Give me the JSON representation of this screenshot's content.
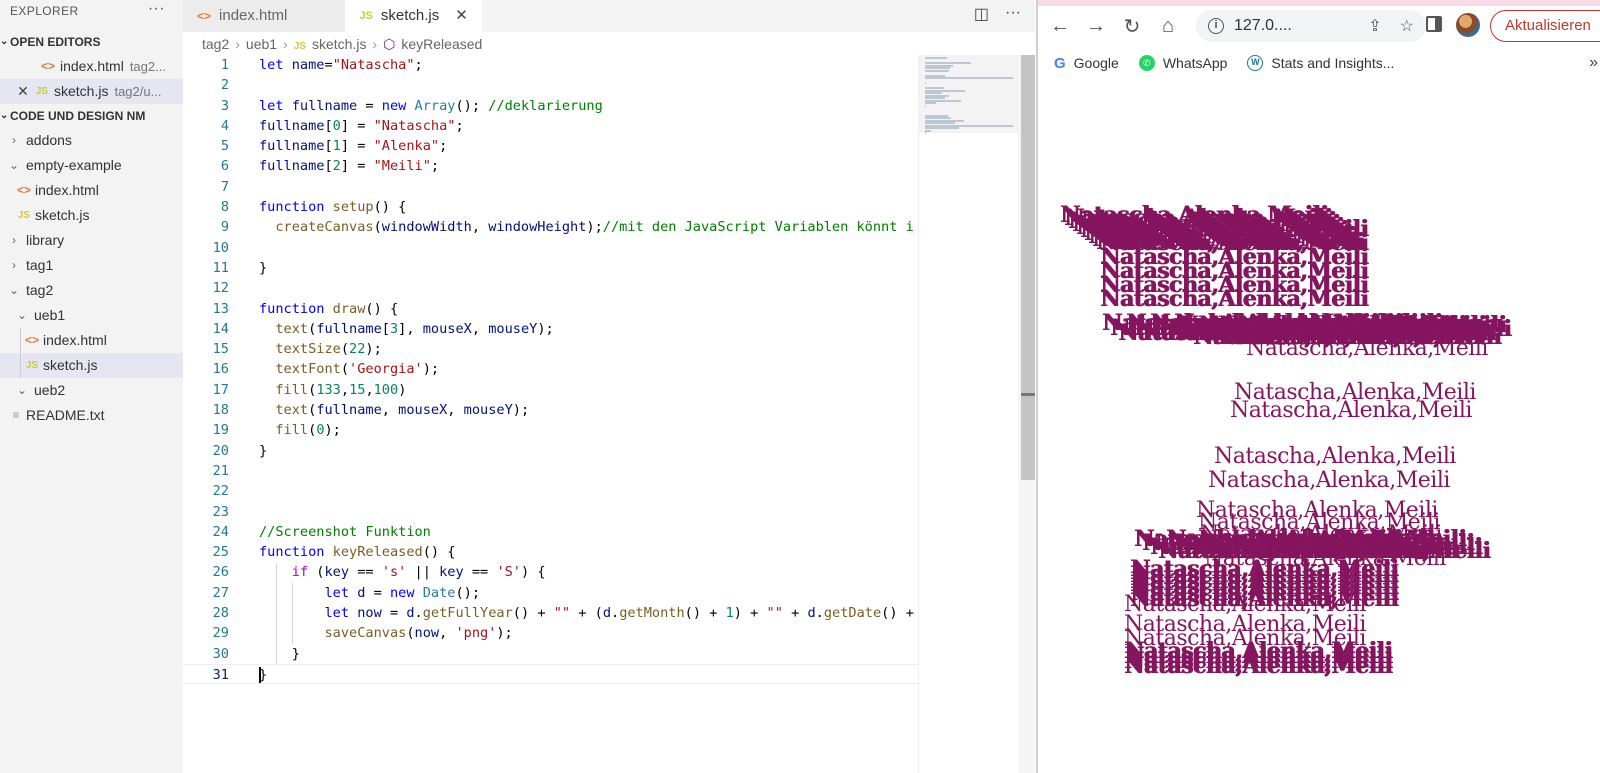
{
  "sidebar": {
    "title": "EXPLORER",
    "more": "···",
    "open_editors_label": "OPEN EDITORS",
    "open_editors": [
      {
        "name": "index.html",
        "path": "tag2..."
      },
      {
        "name": "sketch.js",
        "path": "tag2/u..."
      }
    ],
    "project_label": "CODE UND DESIGN NM",
    "tree": [
      {
        "label": "addons"
      },
      {
        "label": "empty-example"
      },
      {
        "label": "index.html"
      },
      {
        "label": "sketch.js"
      },
      {
        "label": "library"
      },
      {
        "label": "tag1"
      },
      {
        "label": "tag2"
      },
      {
        "label": "ueb1"
      },
      {
        "label": "index.html"
      },
      {
        "label": "sketch.js"
      },
      {
        "label": "ueb2"
      },
      {
        "label": "README.txt"
      }
    ]
  },
  "editor": {
    "tabs": [
      {
        "label": "index.html",
        "icon": "html-file-icon"
      },
      {
        "label": "sketch.js",
        "icon": "js-file-icon"
      }
    ],
    "breadcrumb": [
      "tag2",
      "ueb1",
      "sketch.js",
      "keyReleased"
    ],
    "code_lines": [
      [
        [
          "k",
          "let"
        ],
        [
          "p",
          " "
        ],
        [
          "v",
          "name"
        ],
        [
          "p",
          "="
        ],
        [
          "s",
          "\"Natascha\""
        ],
        [
          "p",
          ";"
        ]
      ],
      [],
      [
        [
          "k",
          "let"
        ],
        [
          "p",
          " "
        ],
        [
          "v",
          "fullname"
        ],
        [
          "p",
          " = "
        ],
        [
          "k",
          "new"
        ],
        [
          "p",
          " "
        ],
        [
          "ty",
          "Array"
        ],
        [
          "p",
          "(); "
        ],
        [
          "cm",
          "//deklarierung"
        ]
      ],
      [
        [
          "v",
          "fullname"
        ],
        [
          "p",
          "["
        ],
        [
          "n",
          "0"
        ],
        [
          "p",
          "] = "
        ],
        [
          "s",
          "\"Natascha\""
        ],
        [
          "p",
          ";"
        ]
      ],
      [
        [
          "v",
          "fullname"
        ],
        [
          "p",
          "["
        ],
        [
          "n",
          "1"
        ],
        [
          "p",
          "] = "
        ],
        [
          "s",
          "\"Alenka\""
        ],
        [
          "p",
          ";"
        ]
      ],
      [
        [
          "v",
          "fullname"
        ],
        [
          "p",
          "["
        ],
        [
          "n",
          "2"
        ],
        [
          "p",
          "] = "
        ],
        [
          "s",
          "\"Meili\""
        ],
        [
          "p",
          ";"
        ]
      ],
      [],
      [
        [
          "k",
          "function"
        ],
        [
          "p",
          " "
        ],
        [
          "fn",
          "setup"
        ],
        [
          "p",
          "() {"
        ]
      ],
      [
        [
          "p",
          "  "
        ],
        [
          "fn",
          "createCanvas"
        ],
        [
          "p",
          "("
        ],
        [
          "v",
          "windowWidth"
        ],
        [
          "p",
          ", "
        ],
        [
          "v",
          "windowHeight"
        ],
        [
          "p",
          ");"
        ],
        [
          "cm",
          "//mit den JavaScript Variablen könnt i"
        ]
      ],
      [],
      [
        [
          "p",
          "}"
        ]
      ],
      [],
      [
        [
          "k",
          "function"
        ],
        [
          "p",
          " "
        ],
        [
          "fn",
          "draw"
        ],
        [
          "p",
          "() {"
        ]
      ],
      [
        [
          "p",
          "  "
        ],
        [
          "fn",
          "text"
        ],
        [
          "p",
          "("
        ],
        [
          "v",
          "fullname"
        ],
        [
          "p",
          "["
        ],
        [
          "n",
          "3"
        ],
        [
          "p",
          "], "
        ],
        [
          "v",
          "mouseX"
        ],
        [
          "p",
          ", "
        ],
        [
          "v",
          "mouseY"
        ],
        [
          "p",
          ");"
        ]
      ],
      [
        [
          "p",
          "  "
        ],
        [
          "fn",
          "textSize"
        ],
        [
          "p",
          "("
        ],
        [
          "n",
          "22"
        ],
        [
          "p",
          ");"
        ]
      ],
      [
        [
          "p",
          "  "
        ],
        [
          "fn",
          "textFont"
        ],
        [
          "p",
          "("
        ],
        [
          "s",
          "'Georgia'"
        ],
        [
          "p",
          ");"
        ]
      ],
      [
        [
          "p",
          "  "
        ],
        [
          "fn",
          "fill"
        ],
        [
          "p",
          "("
        ],
        [
          "n",
          "133"
        ],
        [
          "p",
          ","
        ],
        [
          "n",
          "15"
        ],
        [
          "p",
          ","
        ],
        [
          "n",
          "100"
        ],
        [
          "p",
          ")"
        ]
      ],
      [
        [
          "p",
          "  "
        ],
        [
          "fn",
          "text"
        ],
        [
          "p",
          "("
        ],
        [
          "v",
          "fullname"
        ],
        [
          "p",
          ", "
        ],
        [
          "v",
          "mouseX"
        ],
        [
          "p",
          ", "
        ],
        [
          "v",
          "mouseY"
        ],
        [
          "p",
          ");"
        ]
      ],
      [
        [
          "p",
          "  "
        ],
        [
          "fn",
          "fill"
        ],
        [
          "p",
          "("
        ],
        [
          "n",
          "0"
        ],
        [
          "p",
          ");"
        ]
      ],
      [
        [
          "p",
          "}"
        ]
      ],
      [],
      [],
      [],
      [
        [
          "cm",
          "//Screenshot Funktion"
        ]
      ],
      [
        [
          "k",
          "function"
        ],
        [
          "p",
          " "
        ],
        [
          "fn",
          "keyReleased"
        ],
        [
          "p",
          "() {"
        ]
      ],
      [
        [
          "p",
          "    "
        ],
        [
          "ctrl",
          "if"
        ],
        [
          "p",
          " ("
        ],
        [
          "v",
          "key"
        ],
        [
          "p",
          " == "
        ],
        [
          "s",
          "'s'"
        ],
        [
          "p",
          " || "
        ],
        [
          "v",
          "key"
        ],
        [
          "p",
          " == "
        ],
        [
          "s",
          "'S'"
        ],
        [
          "p",
          ") {"
        ]
      ],
      [
        [
          "p",
          "        "
        ],
        [
          "k",
          "let"
        ],
        [
          "p",
          " "
        ],
        [
          "v",
          "d"
        ],
        [
          "p",
          " = "
        ],
        [
          "k",
          "new"
        ],
        [
          "p",
          " "
        ],
        [
          "ty",
          "Date"
        ],
        [
          "p",
          "();"
        ]
      ],
      [
        [
          "p",
          "        "
        ],
        [
          "k",
          "let"
        ],
        [
          "p",
          " "
        ],
        [
          "v",
          "now"
        ],
        [
          "p",
          " = "
        ],
        [
          "v",
          "d"
        ],
        [
          "p",
          "."
        ],
        [
          "fn",
          "getFullYear"
        ],
        [
          "p",
          "() + "
        ],
        [
          "s",
          "\"\""
        ],
        [
          "p",
          " + ("
        ],
        [
          "v",
          "d"
        ],
        [
          "p",
          "."
        ],
        [
          "fn",
          "getMonth"
        ],
        [
          "p",
          "() + "
        ],
        [
          "n",
          "1"
        ],
        [
          "p",
          ") + "
        ],
        [
          "s",
          "\"\""
        ],
        [
          "p",
          " + "
        ],
        [
          "v",
          "d"
        ],
        [
          "p",
          "."
        ],
        [
          "fn",
          "getDate"
        ],
        [
          "p",
          "() +"
        ]
      ],
      [
        [
          "p",
          "        "
        ],
        [
          "fn",
          "saveCanvas"
        ],
        [
          "p",
          "("
        ],
        [
          "v",
          "now"
        ],
        [
          "p",
          ", "
        ],
        [
          "s",
          "'png'"
        ],
        [
          "p",
          ");"
        ]
      ],
      [
        [
          "p",
          "    }"
        ]
      ],
      [
        [
          "p",
          "}"
        ]
      ]
    ],
    "current_line": 31
  },
  "browser": {
    "url": "127.0....",
    "update_label": "Aktualisieren",
    "bookmarks": [
      {
        "label": "Google",
        "icon": "google-icon"
      },
      {
        "label": "WhatsApp",
        "icon": "whatsapp-icon"
      },
      {
        "label": "Stats and Insights...",
        "icon": "wordpress-icon"
      }
    ],
    "more_bookmarks": "»",
    "canvas_text": "Natascha,Alenka,Meili",
    "canvas_color": "#85155f"
  },
  "colors": {
    "sidebar_bg": "#f3f3f3",
    "selection": "#e4e6f1",
    "update_button": "#c0392b"
  }
}
